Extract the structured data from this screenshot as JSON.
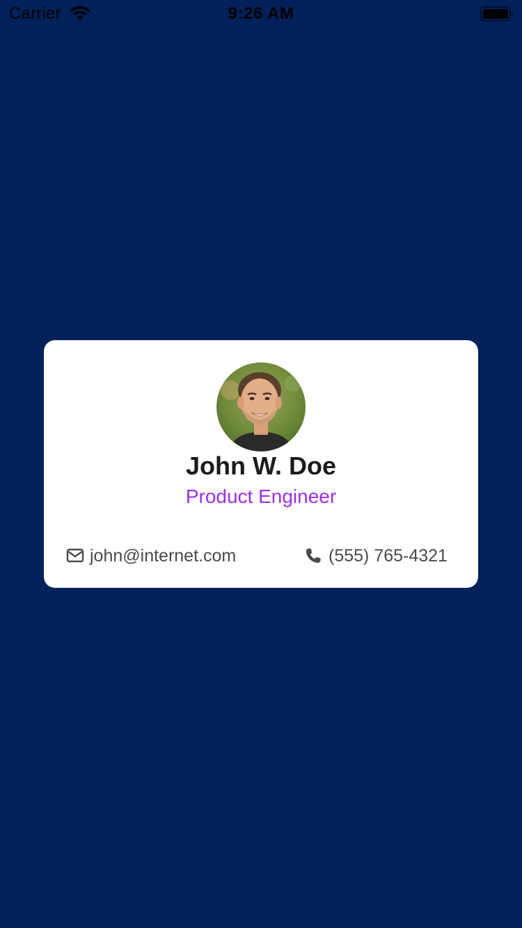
{
  "status_bar": {
    "carrier": "Carrier",
    "time": "9:26 AM",
    "wifi_icon": "wifi-icon",
    "battery_icon": "battery-icon"
  },
  "card": {
    "name": "John W. Doe",
    "title": "Product Engineer",
    "email": "john@internet.com",
    "phone": "(555) 765-4321",
    "email_icon": "envelope-icon",
    "phone_icon": "phone-icon"
  },
  "colors": {
    "background": "#01215a",
    "card": "#ffffff",
    "name": "#1b1b1b",
    "title_accent": "#9b30e8",
    "contact_text": "#4a4a4a"
  }
}
